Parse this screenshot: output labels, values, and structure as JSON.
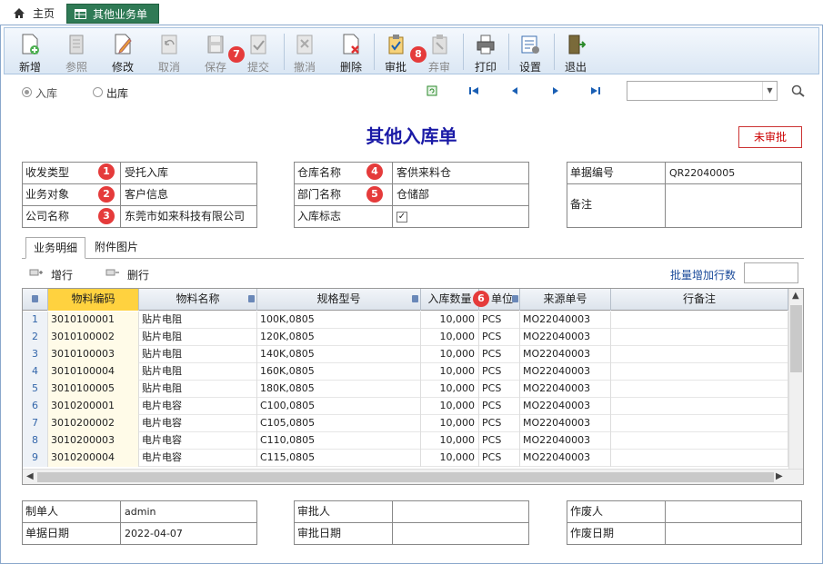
{
  "tabs": {
    "home": "主页",
    "active": "其他业务单"
  },
  "toolbar": {
    "new": "新增",
    "reference": "参照",
    "modify": "修改",
    "cancel": "取消",
    "save": "保存",
    "submit": "提交",
    "revoke": "撤消",
    "delete": "删除",
    "approve": "审批",
    "abandon": "弃审",
    "print": "打印",
    "settings": "设置",
    "exit": "退出"
  },
  "badges": {
    "b1": "1",
    "b2": "2",
    "b3": "3",
    "b4": "4",
    "b5": "5",
    "b6": "6",
    "b7": "7",
    "b8": "8"
  },
  "nav": {
    "in_label": "入库",
    "out_label": "出库",
    "combo_value": ""
  },
  "form": {
    "title": "其他入库单",
    "status": "未审批",
    "recv_type_label": "收发类型",
    "recv_type_value": "受托入库",
    "biz_object_label": "业务对象",
    "biz_object_value": "客户信息",
    "company_label": "公司名称",
    "company_value": "东莞市如来科技有限公司",
    "warehouse_label": "仓库名称",
    "warehouse_value": "客供来料仓",
    "dept_label": "部门名称",
    "dept_value": "仓储部",
    "inbound_flag_label": "入库标志",
    "doc_no_label": "单据编号",
    "doc_no_value": "QR22040005",
    "remark_label": "备注",
    "remark_value": ""
  },
  "subtabs": {
    "detail": "业务明细",
    "attachments": "附件图片"
  },
  "gridbar": {
    "add_row": "增行",
    "delete_row": "删行",
    "batch_label": "批量增加行数",
    "batch_value": ""
  },
  "grid": {
    "columns": [
      "物料编码",
      "物料名称",
      "规格型号",
      "入库数量",
      "单位",
      "来源单号",
      "行备注"
    ],
    "rows": [
      {
        "no": "1",
        "code": "3010100001",
        "name": "贴片电阻",
        "spec": "100K,0805",
        "qty": "10,000",
        "unit": "PCS",
        "src": "MO22040003",
        "note": ""
      },
      {
        "no": "2",
        "code": "3010100002",
        "name": "贴片电阻",
        "spec": "120K,0805",
        "qty": "10,000",
        "unit": "PCS",
        "src": "MO22040003",
        "note": ""
      },
      {
        "no": "3",
        "code": "3010100003",
        "name": "贴片电阻",
        "spec": "140K,0805",
        "qty": "10,000",
        "unit": "PCS",
        "src": "MO22040003",
        "note": ""
      },
      {
        "no": "4",
        "code": "3010100004",
        "name": "贴片电阻",
        "spec": "160K,0805",
        "qty": "10,000",
        "unit": "PCS",
        "src": "MO22040003",
        "note": ""
      },
      {
        "no": "5",
        "code": "3010100005",
        "name": "贴片电阻",
        "spec": "180K,0805",
        "qty": "10,000",
        "unit": "PCS",
        "src": "MO22040003",
        "note": ""
      },
      {
        "no": "6",
        "code": "3010200001",
        "name": "电片电容",
        "spec": "C100,0805",
        "qty": "10,000",
        "unit": "PCS",
        "src": "MO22040003",
        "note": ""
      },
      {
        "no": "7",
        "code": "3010200002",
        "name": "电片电容",
        "spec": "C105,0805",
        "qty": "10,000",
        "unit": "PCS",
        "src": "MO22040003",
        "note": ""
      },
      {
        "no": "8",
        "code": "3010200003",
        "name": "电片电容",
        "spec": "C110,0805",
        "qty": "10,000",
        "unit": "PCS",
        "src": "MO22040003",
        "note": ""
      },
      {
        "no": "9",
        "code": "3010200004",
        "name": "电片电容",
        "spec": "C115,0805",
        "qty": "10,000",
        "unit": "PCS",
        "src": "MO22040003",
        "note": ""
      }
    ]
  },
  "footer": {
    "maker_label": "制单人",
    "maker_value": "admin",
    "date_label": "单据日期",
    "date_value": "2022-04-07",
    "approver_label": "审批人",
    "approver_value": "",
    "approve_date_label": "审批日期",
    "approve_date_value": "",
    "voider_label": "作废人",
    "voider_value": "",
    "void_date_label": "作废日期",
    "void_date_value": ""
  },
  "colors": {
    "accent": "#2f7a55",
    "title": "#1a1aa6",
    "badge": "#e53b3b",
    "selected_header": "#ffd23f"
  }
}
